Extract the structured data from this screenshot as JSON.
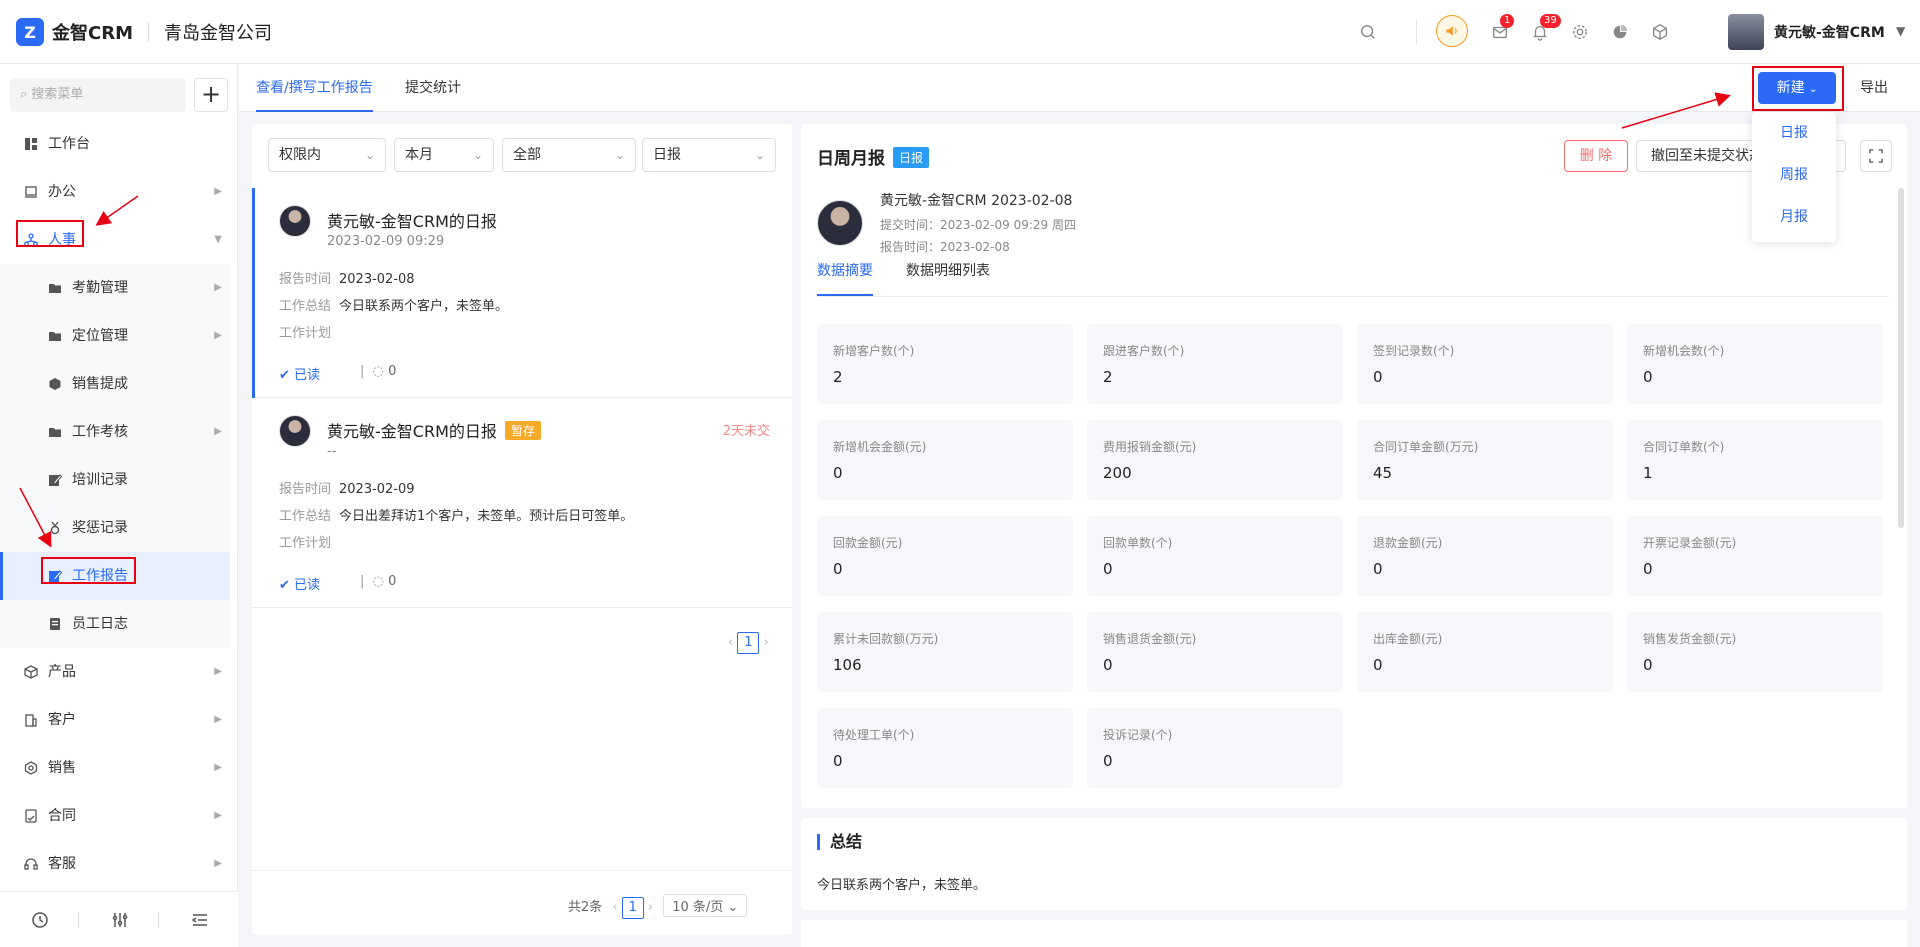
{
  "header": {
    "logo_mark": "Z",
    "logo_text": "金智CRM",
    "company": "青岛金智公司",
    "mail_badge": "1",
    "bell_badge": "39",
    "user_name": "黄元敏-金智CRM",
    "icons": [
      "search-icon",
      "speaker-icon",
      "mail-icon",
      "bell-icon",
      "gear-icon",
      "pie-chart-icon",
      "cube-icon"
    ]
  },
  "sidebar": {
    "search_placeholder": "搜索菜单",
    "add_label": "+",
    "items": [
      {
        "label": "工作台",
        "icon": "dashboard-icon"
      },
      {
        "label": "办公",
        "icon": "office-icon"
      },
      {
        "label": "人事",
        "icon": "org-icon"
      },
      {
        "label": "考勤管理",
        "icon": "folder-icon"
      },
      {
        "label": "定位管理",
        "icon": "folder-icon"
      },
      {
        "label": "销售提成",
        "icon": "hexagon-icon"
      },
      {
        "label": "工作考核",
        "icon": "folder-icon"
      },
      {
        "label": "培训记录",
        "icon": "edit-icon"
      },
      {
        "label": "奖惩记录",
        "icon": "medal-icon"
      },
      {
        "label": "工作报告",
        "icon": "edit-icon"
      },
      {
        "label": "员工日志",
        "icon": "doc-icon"
      },
      {
        "label": "产品",
        "icon": "box-icon"
      },
      {
        "label": "客户",
        "icon": "building-icon"
      },
      {
        "label": "销售",
        "icon": "shield-icon"
      },
      {
        "label": "合同",
        "icon": "contract-icon"
      },
      {
        "label": "客服",
        "icon": "headset-icon"
      }
    ],
    "bottom_icons": [
      "history-icon",
      "sliders-icon",
      "menu-collapse-icon"
    ]
  },
  "tabs": {
    "items": [
      "查看/撰写工作报告",
      "提交统计"
    ],
    "new_label": "新建",
    "export_label": "导出"
  },
  "new_dropdown": [
    "日报",
    "周报",
    "月报"
  ],
  "filters": [
    "权限内",
    "本月",
    "全部",
    "日报"
  ],
  "reports": [
    {
      "title": "黄元敏-金智CRM的日报",
      "sub": "2023-02-09 09:29",
      "draft": "",
      "late": "",
      "report_time_label": "报告时间",
      "report_time": "2023-02-08",
      "summary_label": "工作总结",
      "summary": "今日联系两个客户，未签单。",
      "plan_label": "工作计划",
      "read": "已读",
      "comments": "0"
    },
    {
      "title": "黄元敏-金智CRM的日报",
      "sub": "--",
      "draft": "暂存",
      "late": "2天未交",
      "report_time_label": "报告时间",
      "report_time": "2023-02-09",
      "summary_label": "工作总结",
      "summary": "今日出差拜访1个客户，未签单。预计后日可签单。",
      "plan_label": "工作计划",
      "read": "已读",
      "comments": "0"
    }
  ],
  "list_pager": {
    "page": "1",
    "total": "共2条",
    "per_page": "10 条/页"
  },
  "detail": {
    "title": "日周月报",
    "tag": "日报",
    "delete_label": "删 除",
    "recall_label": "撤回至未提交状态",
    "name_line": "黄元敏-金智CRM 2023-02-08",
    "submit_label": "提交时间：",
    "submit_time": "2023-02-09 09:29 周四",
    "report_label": "报告时间：",
    "report_time": "2023-02-08",
    "tabs": [
      "数据摘要",
      "数据明细列表"
    ],
    "stats": [
      {
        "label": "新增客户数(个)",
        "value": "2"
      },
      {
        "label": "跟进客户数(个)",
        "value": "2"
      },
      {
        "label": "签到记录数(个)",
        "value": "0"
      },
      {
        "label": "新增机会数(个)",
        "value": "0"
      },
      {
        "label": "新增机会金额(元)",
        "value": "0"
      },
      {
        "label": "费用报销金额(元)",
        "value": "200"
      },
      {
        "label": "合同订单金额(万元)",
        "value": "45"
      },
      {
        "label": "合同订单数(个)",
        "value": "1"
      },
      {
        "label": "回款金额(元)",
        "value": "0"
      },
      {
        "label": "回款单数(个)",
        "value": "0"
      },
      {
        "label": "退款金额(元)",
        "value": "0"
      },
      {
        "label": "开票记录金额(元)",
        "value": "0"
      },
      {
        "label": "累计未回款额(万元)",
        "value": "106"
      },
      {
        "label": "销售退货金额(元)",
        "value": "0"
      },
      {
        "label": "出库金额(元)",
        "value": "0"
      },
      {
        "label": "销售发货金额(元)",
        "value": "0"
      },
      {
        "label": "待处理工单(个)",
        "value": "0"
      },
      {
        "label": "投诉记录(个)",
        "value": "0"
      }
    ]
  },
  "summary": {
    "title": "总结",
    "text": "今日联系两个客户，未签单。"
  },
  "colors": {
    "primary": "#2a6af5",
    "annotation": "#e60012",
    "draft": "#f7a928"
  }
}
